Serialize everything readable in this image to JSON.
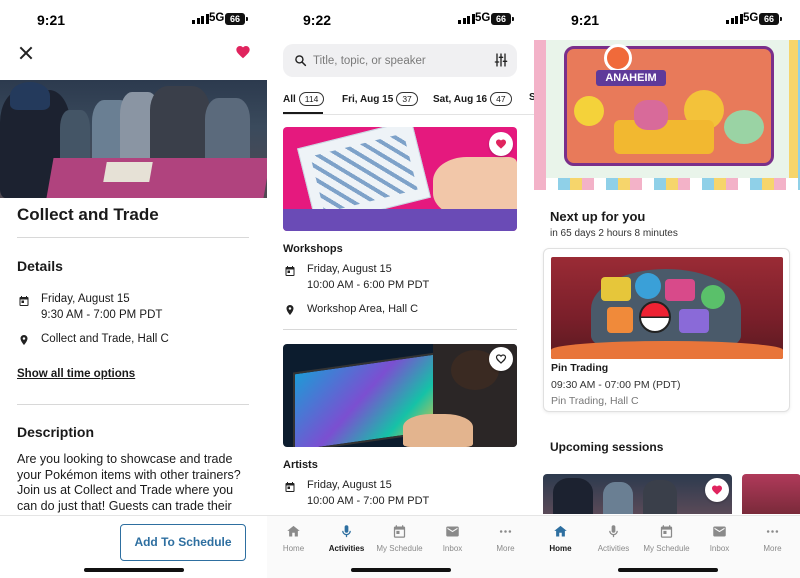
{
  "colors": {
    "accent": "#2e6fa0",
    "heart": "#e0245e",
    "text": "#1a1a1a",
    "muted": "#8a8a8a"
  },
  "screen1": {
    "status": {
      "time": "9:21",
      "network": "5G",
      "battery": "66"
    },
    "title": "Collect and Trade",
    "details_heading": "Details",
    "date": "Friday, August 15",
    "time_range": "9:30 AM - 7:00 PM PDT",
    "location": "Collect and Trade, Hall C",
    "show_all_link": "Show all time options",
    "description_heading": "Description",
    "description": "Are you looking to showcase and trade your Pokémon items with other trainers? Join us at Collect and Trade where you can do just that! Guests can trade their official Pokémon items like plush, play accessories like play",
    "add_button": "Add To Schedule",
    "favorited": true
  },
  "screen2": {
    "status": {
      "time": "9:22",
      "network": "5G",
      "battery": "66"
    },
    "search": {
      "placeholder": "Title, topic, or speaker"
    },
    "tabs": [
      {
        "label": "All",
        "count": "114",
        "active": true
      },
      {
        "label": "Fri, Aug 15",
        "count": "37"
      },
      {
        "label": "Sat, Aug 16",
        "count": "47"
      },
      {
        "label": "S"
      }
    ],
    "cards": [
      {
        "category": "Workshops",
        "date": "Friday, August 15",
        "time": "10:00 AM - 6:00 PM PDT",
        "location": "Workshop Area, Hall C",
        "favorited": true
      },
      {
        "category": "Artists",
        "date": "Friday, August 15",
        "time": "10:00 AM - 7:00 PM PDT",
        "favorited": false
      }
    ]
  },
  "screen3": {
    "status": {
      "time": "9:21",
      "network": "5G",
      "battery": "66"
    },
    "banner_text": "ANAHEIM",
    "next_up_title": "Next up for you",
    "next_up_countdown": "in 65 days 2 hours 8 minutes",
    "next_session": {
      "name": "Pin Trading",
      "time": "09:30 AM - 07:00 PM (PDT)",
      "location": "Pin Trading, Hall C"
    },
    "upcoming_title": "Upcoming sessions"
  },
  "nav": {
    "items": [
      {
        "label": "Home",
        "icon": "home-icon"
      },
      {
        "label": "Activities",
        "icon": "microphone-icon"
      },
      {
        "label": "My Schedule",
        "icon": "calendar-icon"
      },
      {
        "label": "Inbox",
        "icon": "mail-icon"
      },
      {
        "label": "More",
        "icon": "more-icon"
      }
    ],
    "active_screen2": "Activities",
    "active_screen3": "Home"
  }
}
